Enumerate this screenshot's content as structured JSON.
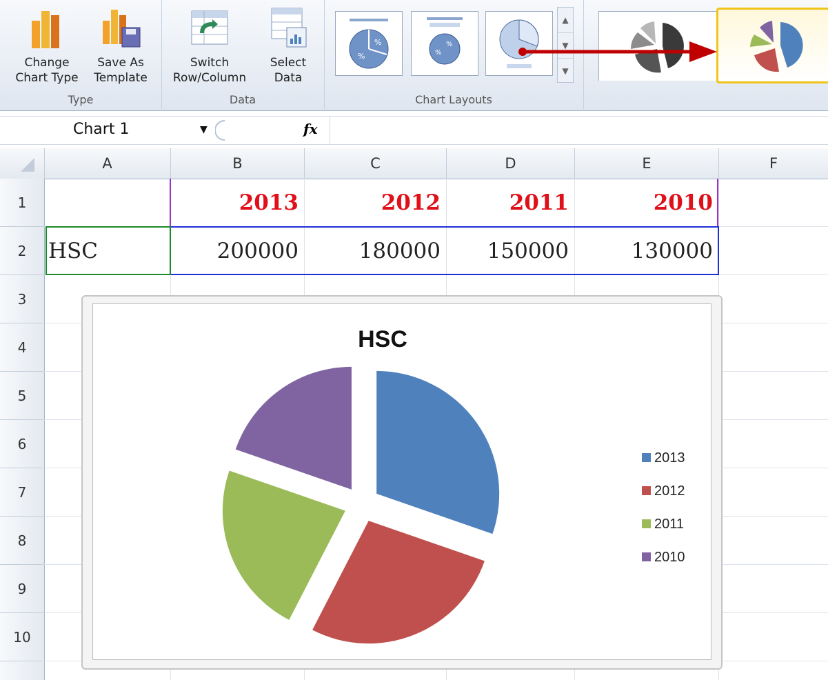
{
  "ribbon": {
    "groups": [
      {
        "label": "Type",
        "buttons": [
          {
            "label": "Change Chart Type",
            "line1": "Change",
            "line2": "Chart Type"
          },
          {
            "label": "Save As Template",
            "line1": "Save As",
            "line2": "Template"
          }
        ]
      },
      {
        "label": "Data",
        "buttons": [
          {
            "label": "Switch Row/Column",
            "line1": "Switch",
            "line2": "Row/Column"
          },
          {
            "label": "Select Data",
            "line1": "Select",
            "line2": "Data"
          }
        ]
      },
      {
        "label": "Chart Layouts"
      }
    ]
  },
  "formula_bar": {
    "name_box": "Chart 1",
    "fx_label": "fx"
  },
  "columns": [
    "A",
    "B",
    "C",
    "D",
    "E",
    "F"
  ],
  "rows": [
    "1",
    "2",
    "3",
    "4",
    "5",
    "6",
    "7",
    "8",
    "9",
    "10"
  ],
  "cells": {
    "B1": "2013",
    "C1": "2012",
    "D1": "2011",
    "E1": "2010",
    "A2": "HSC",
    "B2": "200000",
    "C2": "180000",
    "D2": "150000",
    "E2": "130000"
  },
  "colors": {
    "year_text": "#e0101a",
    "accent_arrow": "#c00000",
    "selected_style_border": "#f0c419"
  },
  "chart_data": {
    "type": "pie",
    "title": "HSC",
    "exploded": true,
    "legend": "right",
    "categories": [
      "2013",
      "2012",
      "2011",
      "2010"
    ],
    "values": [
      200000,
      180000,
      150000,
      130000
    ],
    "colors": [
      "#4f81bd",
      "#c0504d",
      "#9bbb59",
      "#8064a2"
    ]
  }
}
